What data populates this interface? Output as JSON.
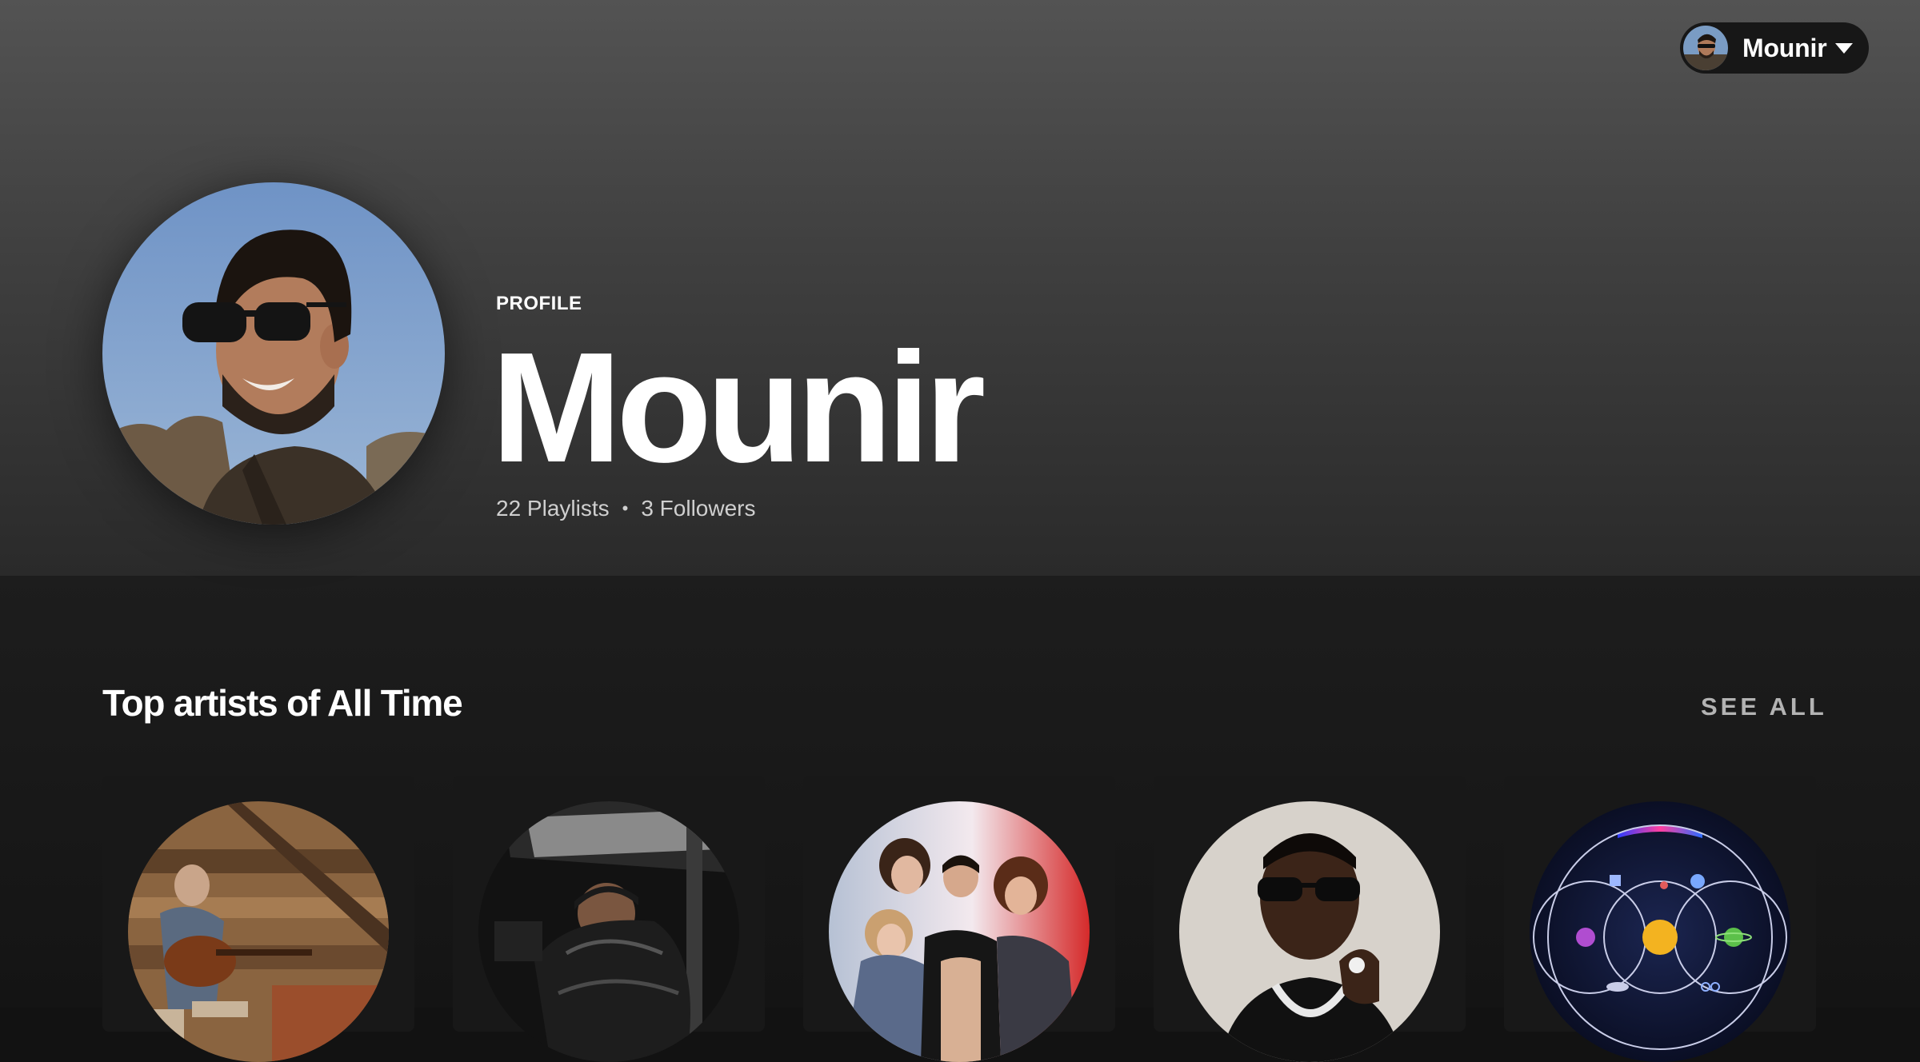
{
  "user_menu": {
    "name": "Mounir",
    "avatar_icon": "user-avatar-photo",
    "caret_icon": "caret-down-icon"
  },
  "profile": {
    "type_label": "PROFILE",
    "name": "Mounir",
    "playlists": "22 Playlists",
    "separator": "•",
    "followers": "3 Followers"
  },
  "section": {
    "title": "Top artists of All Time",
    "see_all": "SEE ALL"
  },
  "artists": [
    {
      "image": "guitarist-in-wooden-attic"
    },
    {
      "image": "man-in-car-black-puffer"
    },
    {
      "image": "band-group-photo-red-backdrop"
    },
    {
      "image": "man-with-sunglasses-and-chain"
    },
    {
      "image": "planets-album-art"
    }
  ],
  "colors": {
    "background": "#121212",
    "card": "#181818",
    "text_secondary": "#b3b3b3",
    "header_top": "#535353"
  }
}
